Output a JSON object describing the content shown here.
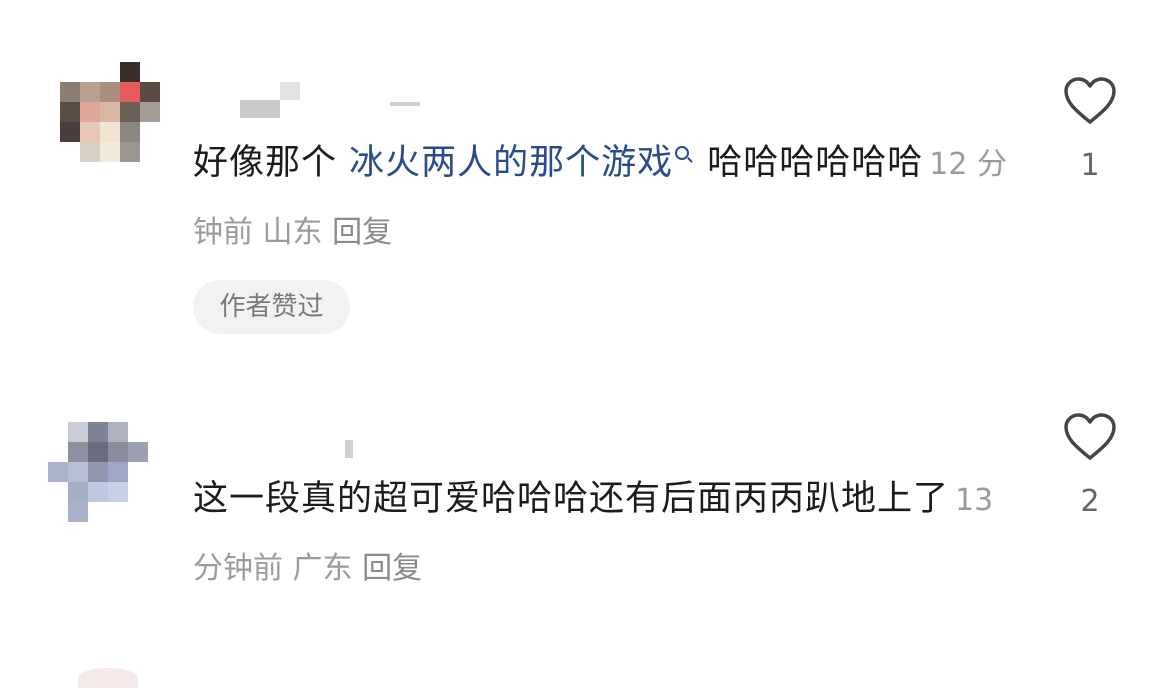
{
  "comments": [
    {
      "text_before": "好像那个 ",
      "link_text": "冰火两人的那个游戏",
      "text_after": " 哈哈哈哈哈哈",
      "time": "12 分钟前",
      "location": "山东",
      "reply_label": "回复",
      "badge": "作者赞过",
      "likes": "1"
    },
    {
      "text": "这一段真的超可爱哈哈哈还有后面丙丙趴地上了",
      "time": "13 分钟前",
      "location": "广东",
      "reply_label": "回复",
      "likes": "2"
    }
  ],
  "icons": {
    "like": "heart-outline-icon",
    "search": "search-icon"
  },
  "colors": {
    "link": "#2a4b8d",
    "meta": "#9b9b9b",
    "badge_bg": "#f2f2f2"
  }
}
